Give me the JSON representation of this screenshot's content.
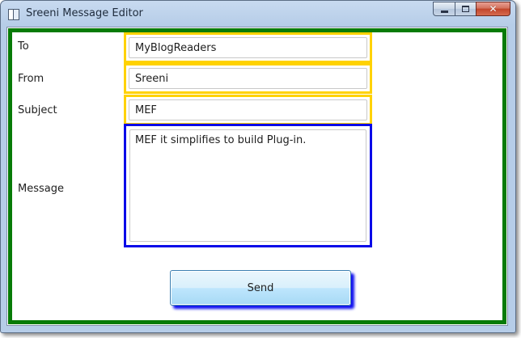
{
  "window": {
    "title": "Sreeni Message Editor",
    "controls": {
      "minimize_icon": "minimize-icon",
      "maximize_icon": "maximize-icon",
      "close_icon": "close-icon",
      "close_glyph": "✕"
    }
  },
  "form": {
    "to": {
      "label": "To",
      "value": "MyBlogReaders"
    },
    "from": {
      "label": "From",
      "value": "Sreeni"
    },
    "subject": {
      "label": "Subject",
      "value": "MEF"
    },
    "message": {
      "label": "Message",
      "value": "MEF it simplifies to build Plug-in."
    },
    "send_label": "Send"
  },
  "colors": {
    "outer_border": "#077b07",
    "field_border": "#ffd200",
    "message_border": "#0a0ae8",
    "send_shadow": "#1010f0"
  }
}
